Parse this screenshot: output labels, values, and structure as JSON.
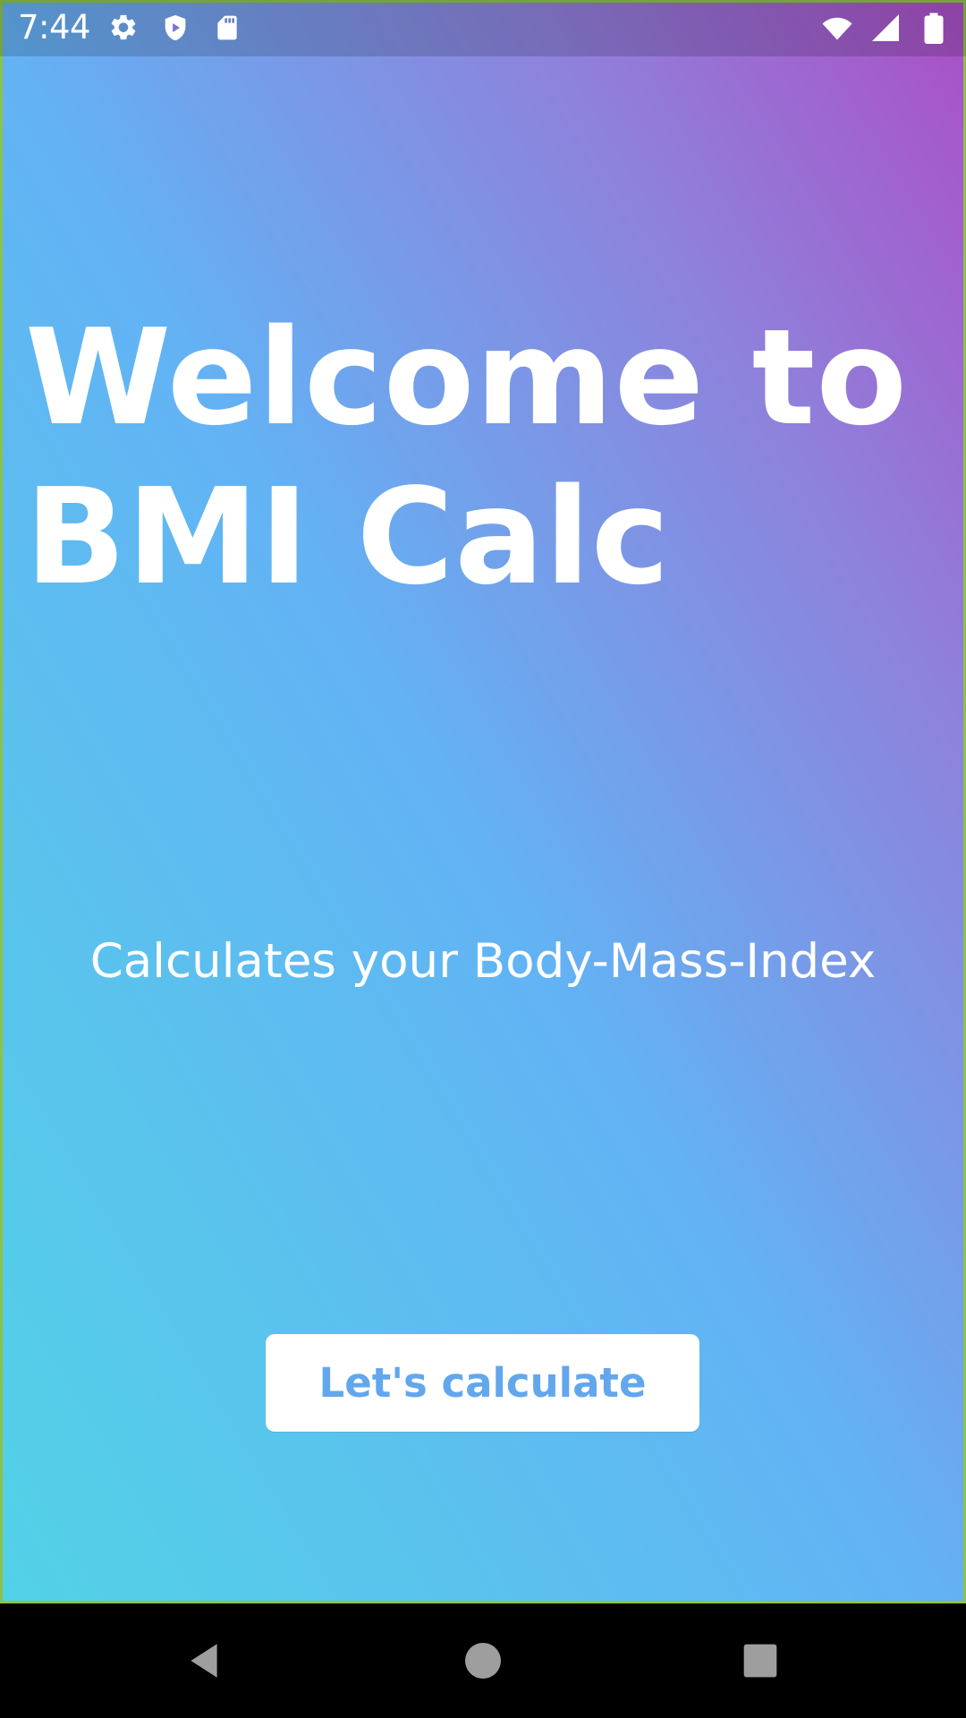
{
  "status_bar": {
    "time": "7:44",
    "left_icons": [
      "gear-icon",
      "shield-play-icon",
      "sd-card-icon"
    ],
    "right_icons": [
      "wifi-icon",
      "cellular-signal-icon",
      "battery-icon"
    ]
  },
  "welcome": {
    "title_line1": "Welcome to",
    "title_line2": "BMI Calc",
    "subtitle": "Calculates your Body-Mass-Index",
    "button_label": "Let's calculate"
  },
  "nav_bar": {
    "buttons": [
      "back-icon",
      "home-icon",
      "recents-icon"
    ]
  },
  "colors": {
    "gradient_bottom": "#52d2e6",
    "gradient_middle": "#62b3f4",
    "gradient_top": "#ab4fc6",
    "button_text": "#62a7ed"
  }
}
